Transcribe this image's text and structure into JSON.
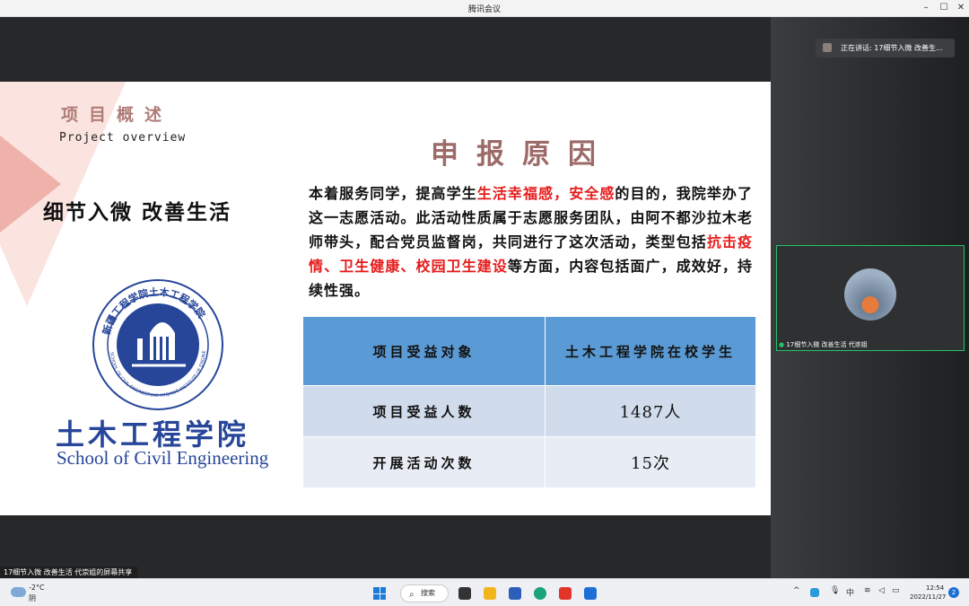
{
  "window": {
    "title": "腾讯会议",
    "minimize": "–",
    "maximize": "☐",
    "close": "✕"
  },
  "slide": {
    "section_title": "项目概述",
    "section_subtitle": "Project overview",
    "slogan": "细节入微 改善生活",
    "school_name_cn": "土木工程学院",
    "school_name_en": "School of Civil Engineering",
    "seal_text_top": "新疆工程学院土木工程学院",
    "seal_text_bottom": "SCHOOL OF CIVIL ENGINEERING XINJIANG INSTITUTE OF ENGINEERING",
    "reason_title": "申报原因",
    "reason_body": {
      "p1": "本着服务同学，提高学生",
      "h1": "生活幸福感，安全感",
      "p2": "的目的，我院举办了这一志愿活动。此活动性质属于志愿服务团队，由阿不都沙拉木老师带头，配合党员监督岗，共同进行了这次活动，类型包括",
      "h2": "抗击疫情、卫生健康、校园卫生建设",
      "p3": "等方面，内容包括面广，成效好，持续性强。"
    },
    "table": {
      "rows": [
        {
          "label": "项目受益对象",
          "value": "土木工程学院在校学生"
        },
        {
          "label": "项目受益人数",
          "value": "1487人"
        },
        {
          "label": "开展活动次数",
          "value": "15次"
        }
      ]
    }
  },
  "share_label": "17细节入微 改善生活 代崇姐的屏幕共享",
  "side": {
    "speaking": "正在讲话: 17细节入微 改善生...",
    "participant_name": "17细节入微 改善生活 代崇姐"
  },
  "taskbar": {
    "weather_temp": "-2°C",
    "weather_cond": "阴",
    "search_label": "搜索",
    "ime": "中",
    "time": "12:54",
    "date": "2022/11/27",
    "notifications": "2",
    "tray_up": "^"
  },
  "colors": {
    "accent": "#5b9bd5",
    "highlight": "#e61b1b",
    "school_blue": "#27469a",
    "speaking_border": "#25c26b"
  }
}
